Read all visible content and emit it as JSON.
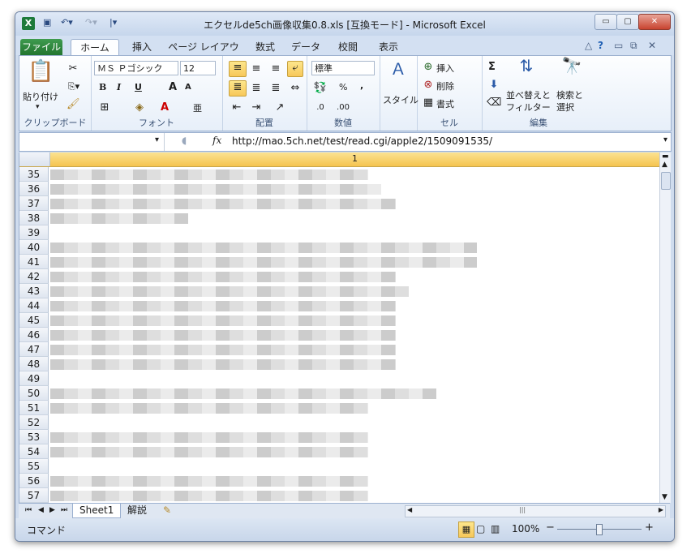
{
  "window": {
    "title": "エクセルde5ch画像収集0.8.xls  [互換モード] - Microsoft Excel",
    "excel_icon": "X",
    "quick_access": [
      "save-icon",
      "undo-icon",
      "redo-icon",
      "customize-qat-icon"
    ],
    "controls": {
      "minimize": "▭",
      "maximize": "▢",
      "close": "✕"
    }
  },
  "tabs": [
    "ファイル",
    "ホーム",
    "挿入",
    "ページ レイアウト",
    "数式",
    "データ",
    "校閲",
    "表示"
  ],
  "ribbon": {
    "clipboard": {
      "label": "クリップボード",
      "paste": "貼り付け"
    },
    "font": {
      "label": "フォント",
      "font_name": "ＭＳ Ｐゴシック",
      "font_size": "12",
      "bold": "B",
      "italic": "I",
      "underline": "U",
      "grow": "A",
      "shrink": "A",
      "furigana": "亜"
    },
    "alignment": {
      "label": "配置"
    },
    "number": {
      "label": "数値",
      "format": "標準",
      "percent": "%",
      "comma": ","
    },
    "styles": {
      "label": "スタイル"
    },
    "cells": {
      "label": "セル",
      "insert": "挿入",
      "delete": "削除",
      "format": "書式"
    },
    "editing": {
      "label": "編集",
      "sigma": "Σ",
      "sort": "並べ替えと",
      "sort2": "フィルター",
      "find": "検索と",
      "find2": "選択"
    }
  },
  "formula_bar": {
    "fx": "fx",
    "value": "http://mao.5ch.net/test/read.cgi/apple2/1509091535/"
  },
  "grid": {
    "column_header": "1",
    "rows": [
      "35",
      "36",
      "37",
      "38",
      "39",
      "40",
      "41",
      "42",
      "43",
      "44",
      "45",
      "46",
      "47",
      "48",
      "49",
      "50",
      "51",
      "52",
      "53",
      "54",
      "55",
      "56",
      "57"
    ]
  },
  "sheets": [
    "Sheet1",
    "解説"
  ],
  "status": {
    "mode": "コマンド",
    "zoom": "100%",
    "zoom_out": "−",
    "zoom_in": "+"
  }
}
